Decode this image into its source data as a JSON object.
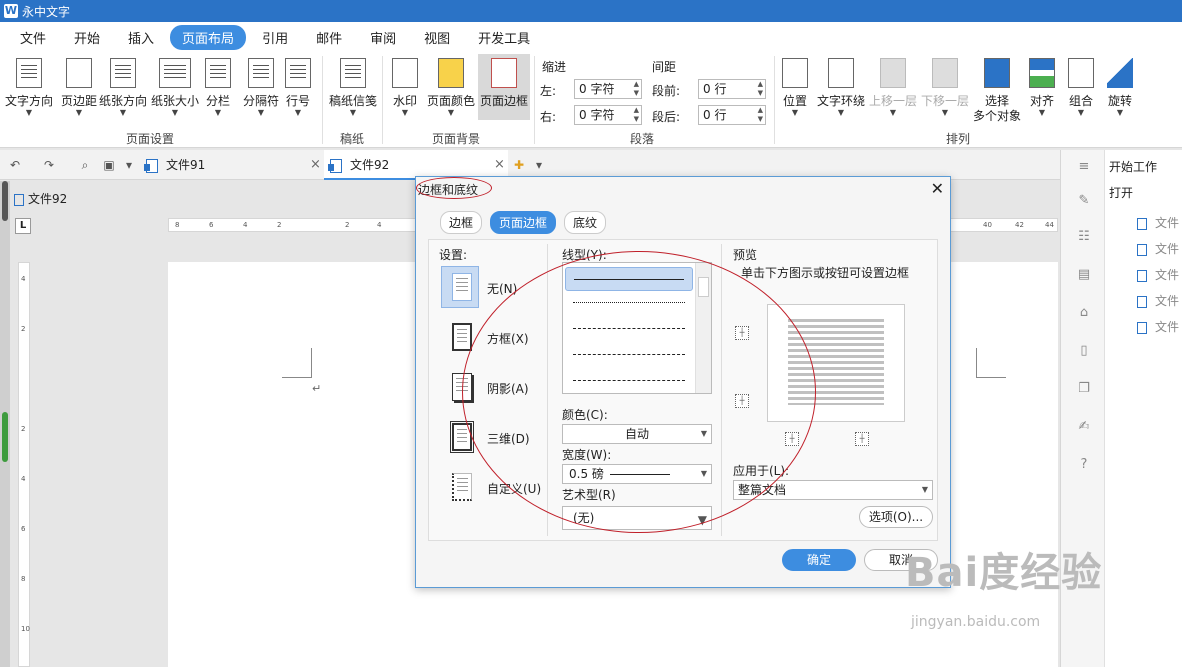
{
  "app": {
    "logo": "W",
    "title": "永中文字"
  },
  "menu": {
    "tabs": [
      "文件",
      "开始",
      "插入",
      "页面布局",
      "引用",
      "邮件",
      "审阅",
      "视图",
      "开发工具"
    ],
    "active": "页面布局"
  },
  "ribbon": {
    "page_setup": {
      "buttons": [
        "文字方向",
        "页边距",
        "纸张方向",
        "纸张大小",
        "分栏",
        "分隔符",
        "行号"
      ],
      "label": "页面设置"
    },
    "manuscript": {
      "buttons": [
        "稿纸信笺"
      ],
      "label": "稿纸"
    },
    "background": {
      "buttons": [
        "水印",
        "页面颜色",
        "页面边框"
      ],
      "label": "页面背景"
    },
    "paragraph": {
      "indent_title": "缩进",
      "spacing_title": "间距",
      "left_label": "左:",
      "left_value": "0 字符",
      "right_label": "右:",
      "right_value": "0 字符",
      "before_label": "段前:",
      "before_value": "0 行",
      "after_label": "段后:",
      "after_value": "0 行",
      "label": "段落"
    },
    "arrange": {
      "buttons": [
        "位置",
        "文字环绕",
        "上移一层",
        "下移一层",
        "选择\n多个对象",
        "对齐",
        "组合",
        "旋转"
      ],
      "select_line1": "选择",
      "select_line2": "多个对象",
      "label": "排列"
    }
  },
  "doc_tabs": [
    {
      "name": "文件91",
      "active": false
    },
    {
      "name": "文件92",
      "active": true
    }
  ],
  "doc_path": "文件92",
  "ruler": {
    "h_ticks": [
      "8",
      "6",
      "4",
      "2",
      "2",
      "4",
      "40",
      "42",
      "44"
    ],
    "v_ticks": [
      "4",
      "2",
      "2",
      "4",
      "6",
      "8",
      "10"
    ],
    "tab_marker": "L"
  },
  "right_panel": {
    "title": "开始工作",
    "open": "打开",
    "files": [
      "文件",
      "文件",
      "文件",
      "文件",
      "文件"
    ]
  },
  "dialog": {
    "title": "边框和底纹",
    "tabs": [
      "边框",
      "页面边框",
      "底纹"
    ],
    "active_tab": "页面边框",
    "settings_label": "设置:",
    "settings": [
      "无(N)",
      "方框(X)",
      "阴影(A)",
      "三维(D)",
      "自定义(U)"
    ],
    "line_style_label": "线型(Y):",
    "color_label": "颜色(C):",
    "color_value": "自动",
    "width_label": "宽度(W):",
    "width_value": "0.5  磅",
    "art_label": "艺术型(R)",
    "art_value": "(无)",
    "preview_label": "预览",
    "preview_hint": "单击下方图示或按钮可设置边框",
    "apply_label": "应用于(L):",
    "apply_value": "整篇文档",
    "options_button": "选项(O)...",
    "ok_button": "确定",
    "cancel_button": "取消"
  },
  "watermark": {
    "main": "Bai度经验",
    "sub": "jingyan.baidu.com"
  },
  "colors": {
    "accent": "#3d8de0",
    "titlebar": "#2b73c6",
    "annotation": "#c0202a"
  }
}
